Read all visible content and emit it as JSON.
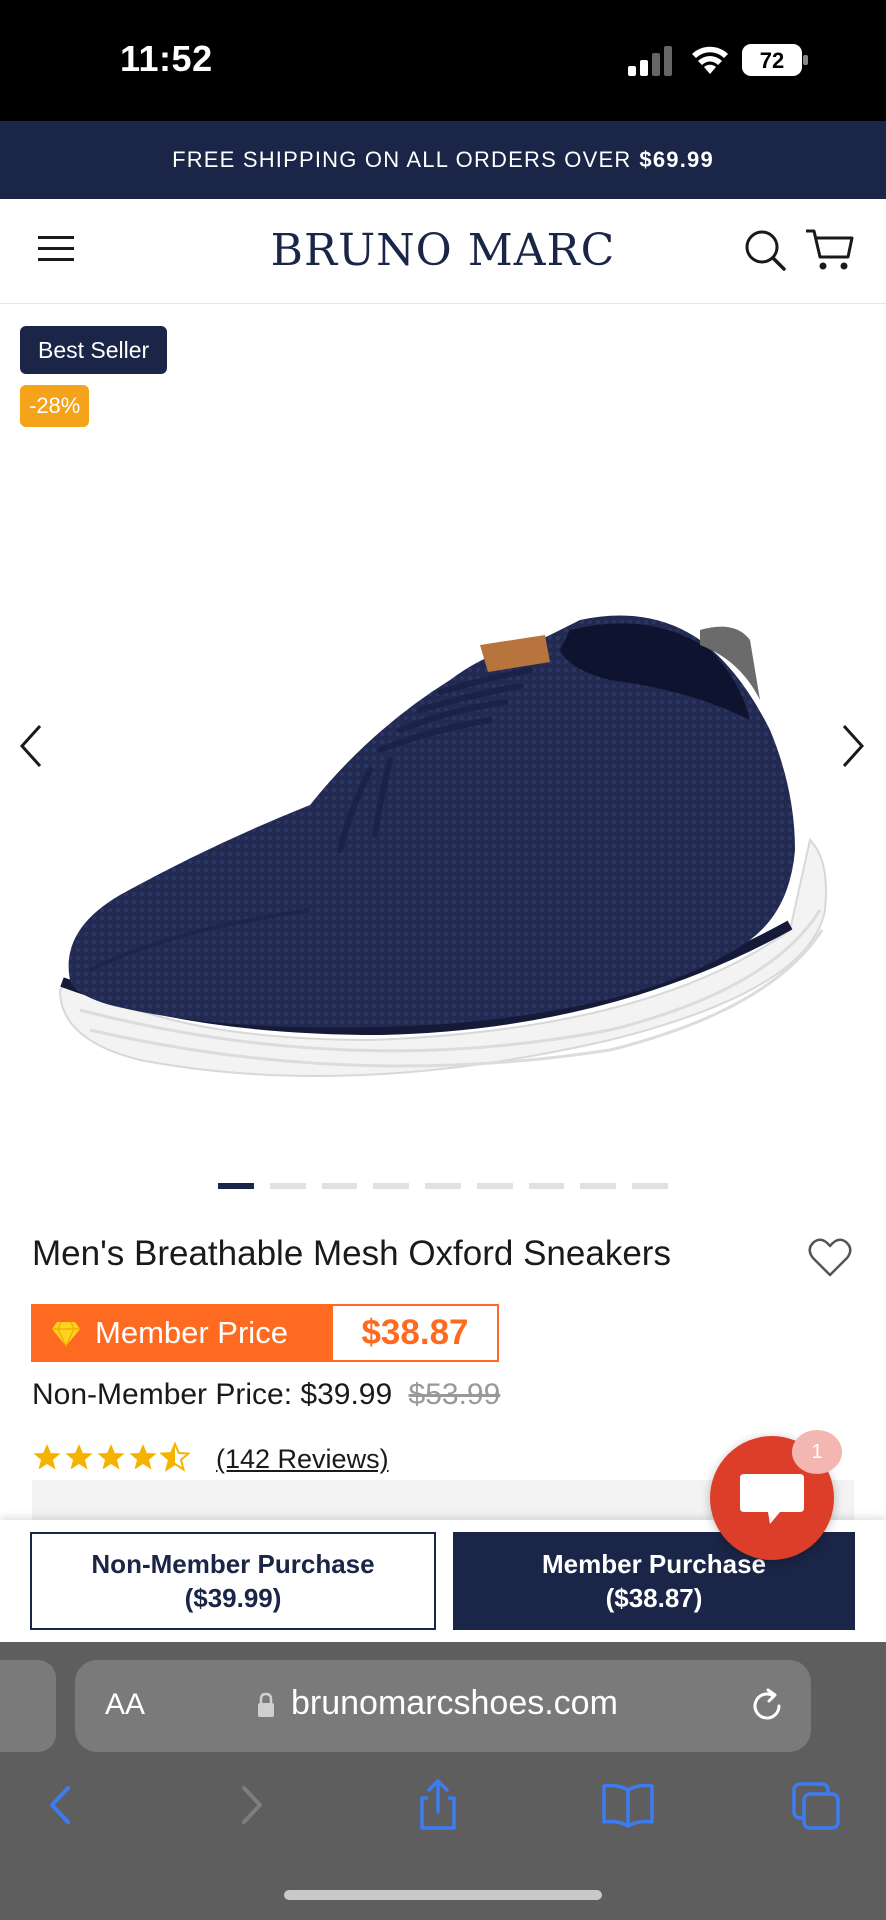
{
  "status_bar": {
    "time": "11:52",
    "battery": "72"
  },
  "promo": {
    "text": "FREE SHIPPING ON ALL ORDERS OVER",
    "amount": "$69.99"
  },
  "header": {
    "logo": "BRUNO MARC"
  },
  "badges": {
    "best_seller": "Best Seller",
    "discount": "-28%"
  },
  "carousel": {
    "image_count": 9,
    "active_index": 0
  },
  "product": {
    "title": "Men's Breathable Mesh Oxford Sneakers",
    "member_label": "Member Price",
    "member_price": "$38.87",
    "nonmember_label": "Non-Member Price: $39.99",
    "original_price": "$53.99",
    "rating": 4.5,
    "reviews": "(142 Reviews)"
  },
  "chat": {
    "badge": "1"
  },
  "purchase": {
    "nonmember_line1": "Non-Member Purchase",
    "nonmember_line2": "($39.99)",
    "member_line1": "Member Purchase",
    "member_line2": "($38.87)"
  },
  "browser": {
    "aa": "AA",
    "url": "brunomarcshoes.com"
  },
  "colors": {
    "navy": "#1a2547",
    "orange": "#ff6a21",
    "badge_orange": "#f5a31a",
    "chat_red": "#dc3e2a",
    "safari_blue": "#3d7cf0"
  }
}
